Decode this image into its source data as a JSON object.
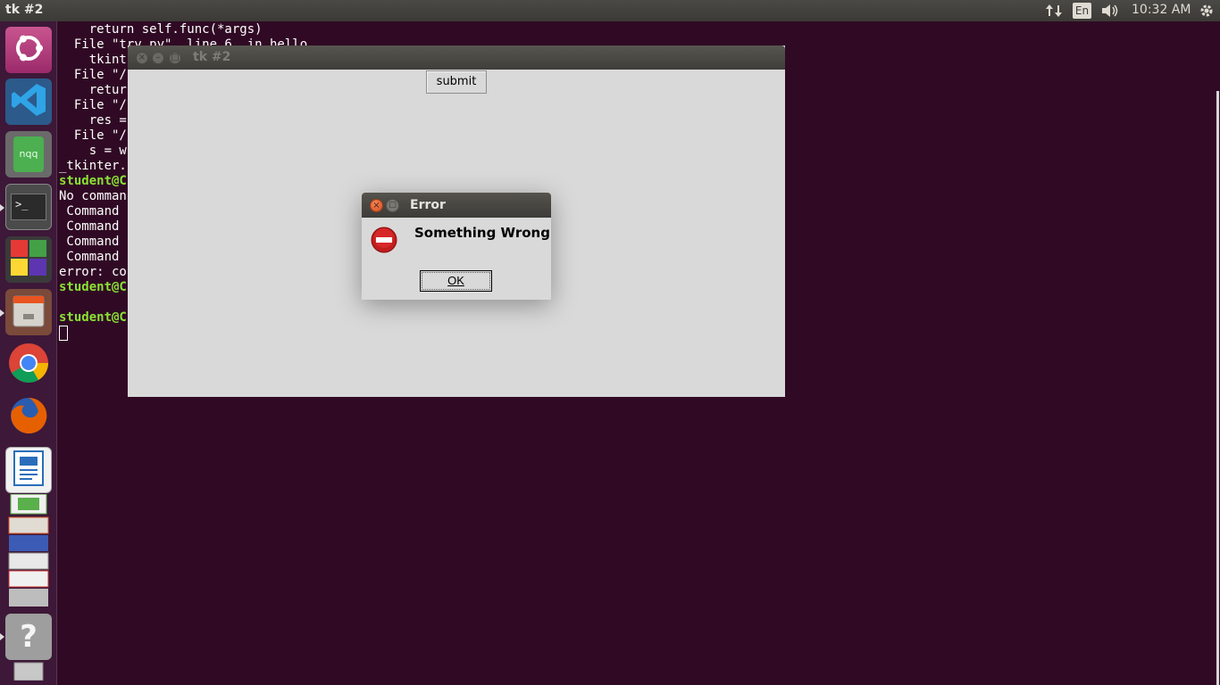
{
  "top_panel": {
    "app_title": "tk #2",
    "keyboard_layout": "En",
    "clock": "10:32 AM"
  },
  "launcher": {
    "items": [
      {
        "name": "Ubuntu Dash",
        "icon": "ubuntu-logo-icon"
      },
      {
        "name": "Visual Studio Code",
        "icon": "vscode-icon"
      },
      {
        "name": "nqq",
        "icon": "notepadqq-icon",
        "label": "nqq"
      },
      {
        "name": "Terminal",
        "icon": "terminal-icon"
      },
      {
        "name": "App Grid",
        "icon": "app-grid-icon"
      },
      {
        "name": "Files",
        "icon": "file-cabinet-icon"
      },
      {
        "name": "Chrome",
        "icon": "chrome-icon"
      },
      {
        "name": "Firefox",
        "icon": "firefox-icon"
      },
      {
        "name": "LibreOffice Writer",
        "icon": "writer-icon"
      },
      {
        "name": "Stacked Apps",
        "icon": "stacked-apps-icon"
      },
      {
        "name": "Help",
        "icon": "help-icon",
        "label": "?"
      },
      {
        "name": "Trash",
        "icon": "trash-icon"
      }
    ]
  },
  "terminal": {
    "lines": [
      {
        "text": "    return self.func(*args)",
        "prompt": false
      },
      {
        "text": "  File \"try.py\", line 6, in hello",
        "prompt": false
      },
      {
        "text": "    tkint",
        "prompt": false
      },
      {
        "text": "  File \"/",
        "prompt": false
      },
      {
        "text": "    retur",
        "prompt": false
      },
      {
        "text": "  File \"/",
        "prompt": false
      },
      {
        "text": "    res =",
        "prompt": false
      },
      {
        "text": "  File \"/",
        "prompt": false
      },
      {
        "text": "    s = w",
        "prompt": false
      },
      {
        "text": "_tkinter.",
        "prompt": false
      },
      {
        "text": "student@C",
        "prompt": true
      },
      {
        "text": "No comman",
        "prompt": false
      },
      {
        "text": " Command ",
        "prompt": false
      },
      {
        "text": " Command ",
        "prompt": false
      },
      {
        "text": " Command ",
        "prompt": false
      },
      {
        "text": " Command ",
        "prompt": false
      },
      {
        "text": "error: co",
        "prompt": false
      },
      {
        "text": "student@C",
        "prompt": true
      },
      {
        "text": "",
        "prompt": false
      },
      {
        "text": "student@C",
        "prompt": true
      }
    ]
  },
  "tk_window": {
    "title": "tk #2",
    "submit_label": "submit"
  },
  "error_dialog": {
    "title": "Error",
    "message": "Something Wrong",
    "ok_label": "OK"
  },
  "colors": {
    "desktop_bg": "#300a24",
    "prompt_green": "#8ae234",
    "tk_bg": "#d9d9d9"
  }
}
